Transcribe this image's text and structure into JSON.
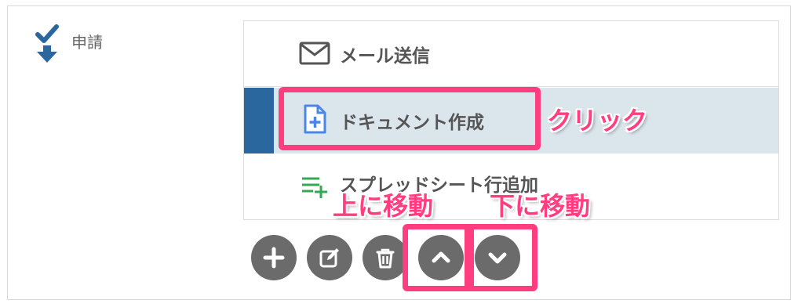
{
  "section": {
    "label": "申請",
    "icon": "check-down-arrow-icon",
    "icon_color": "#2a679f"
  },
  "list": {
    "items": [
      {
        "label": "メール送信",
        "icon": "envelope-icon",
        "selected": false
      },
      {
        "label": "ドキュメント作成",
        "icon": "document-add-icon",
        "selected": true
      },
      {
        "label": "スプレッドシート行追加",
        "icon": "list-add-icon",
        "selected": false
      }
    ],
    "selected_bg": "#dbe5ec",
    "selected_marker": "#2a679f"
  },
  "toolbar": {
    "buttons": [
      {
        "name": "add",
        "icon": "plus-icon"
      },
      {
        "name": "edit",
        "icon": "edit-icon"
      },
      {
        "name": "delete",
        "icon": "trash-icon"
      },
      {
        "name": "move-up",
        "icon": "chevron-up-icon"
      },
      {
        "name": "move-down",
        "icon": "chevron-down-icon"
      }
    ],
    "button_color": "#6b6b6b"
  },
  "annotations": {
    "click": "クリック",
    "move_up": "上に移動",
    "move_down": "下に移動",
    "color": "#ff3d7f"
  }
}
